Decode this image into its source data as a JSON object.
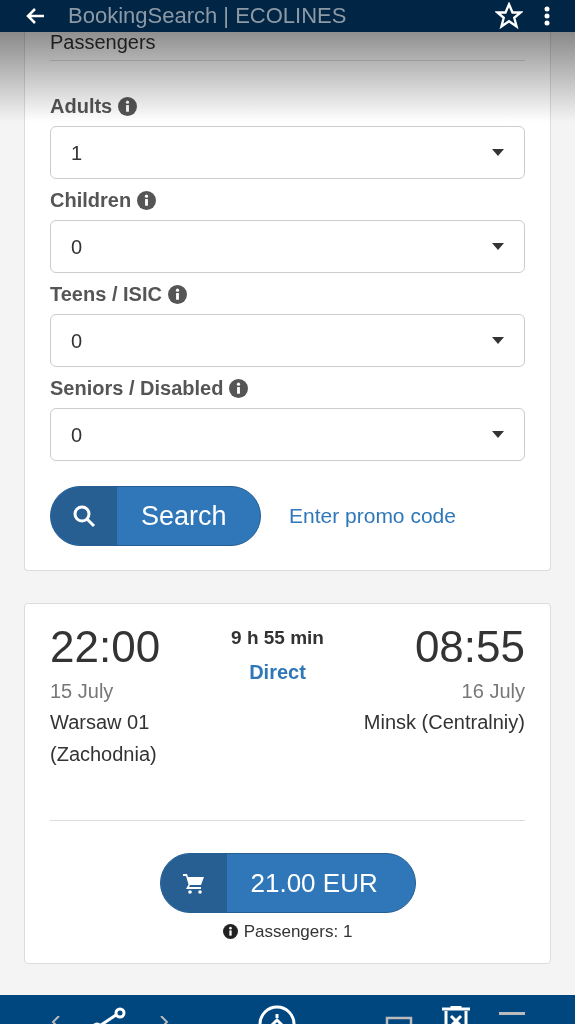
{
  "top_bar": {
    "title": "BookingSearch | ECOLINES"
  },
  "passengers": {
    "heading": "Passengers",
    "fields": [
      {
        "label": "Adults",
        "value": "1"
      },
      {
        "label": "Children",
        "value": "0"
      },
      {
        "label": "Teens / ISIC",
        "value": "0"
      },
      {
        "label": "Seniors / Disabled",
        "value": "0"
      }
    ],
    "search_button": "Search",
    "promo_link": "Enter promo code"
  },
  "trip": {
    "depart_time": "22:00",
    "depart_date": "15 July",
    "depart_station": "Warsaw 01 (Zachodnia)",
    "duration": "9 h 55 min",
    "type": "Direct",
    "arrive_time": "08:55",
    "arrive_date": "16 July",
    "arrive_station": "Minsk (Centralniy)",
    "price": "21.00 EUR",
    "passengers_note": "Passengers: 1"
  }
}
